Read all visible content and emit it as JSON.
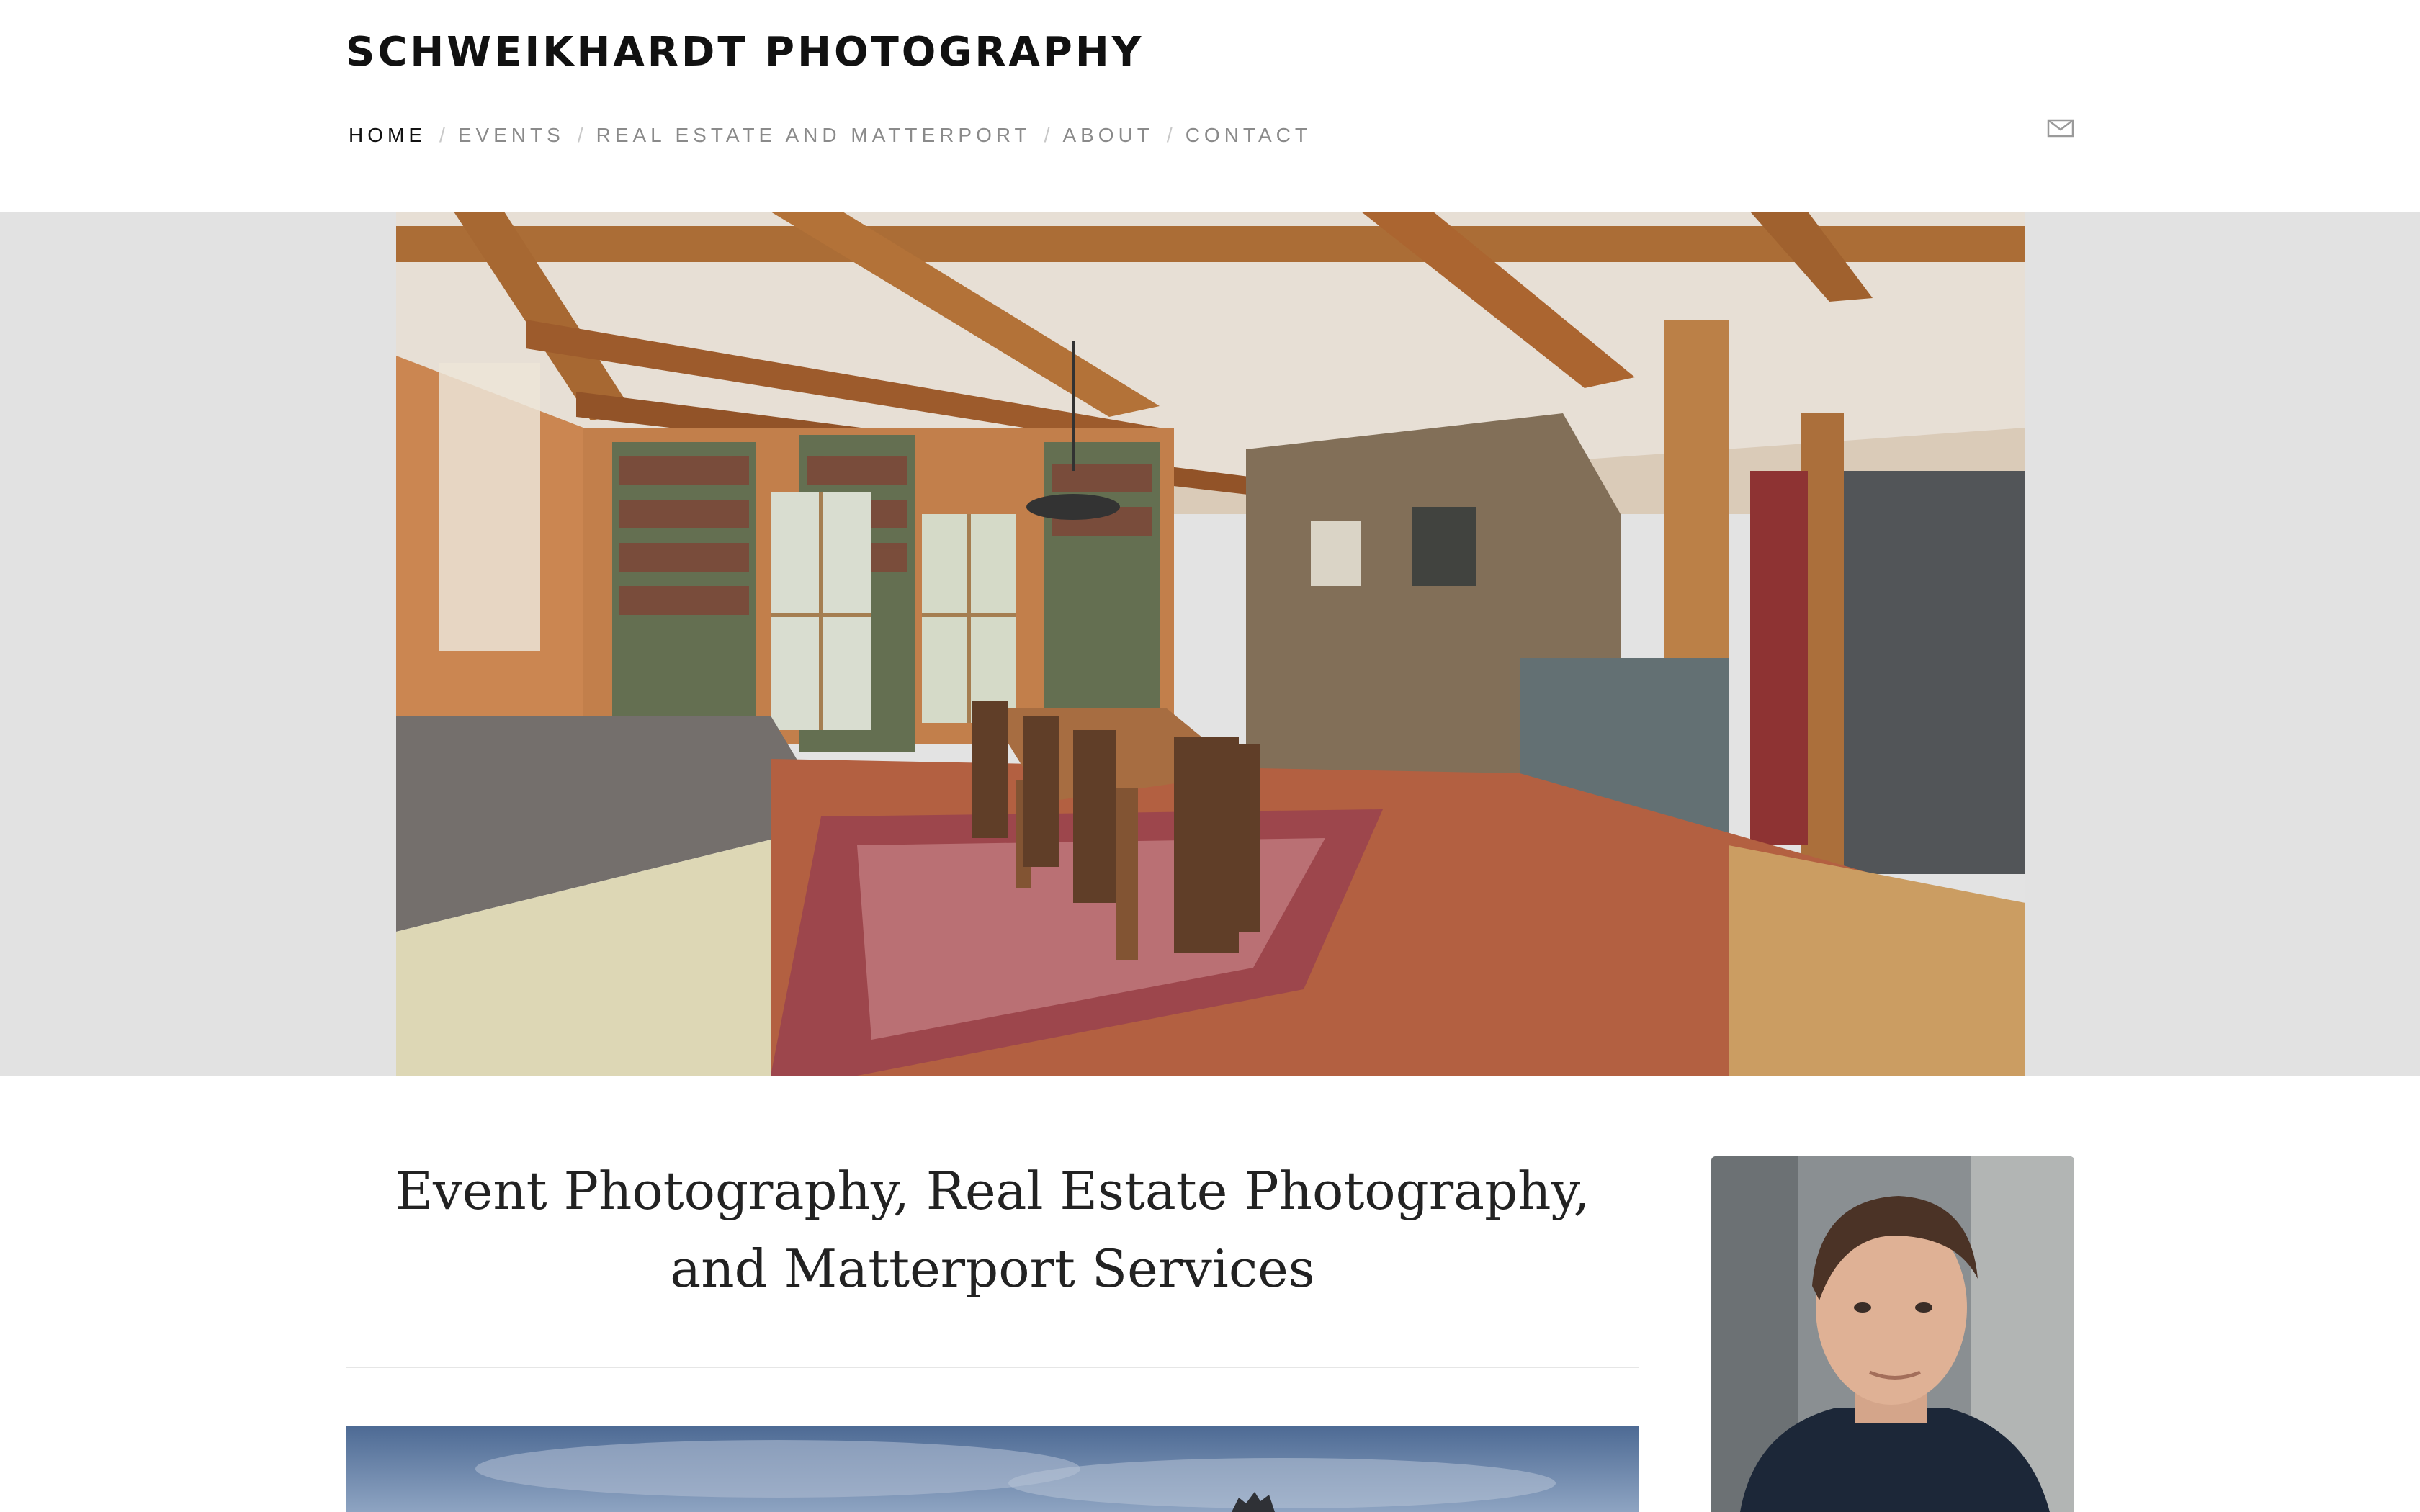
{
  "site": {
    "title": "SCHWEIKHARDT PHOTOGRAPHY"
  },
  "nav": {
    "separator": "/",
    "items": [
      {
        "label": "HOME",
        "active": true
      },
      {
        "label": "EVENTS",
        "active": false
      },
      {
        "label": "REAL ESTATE AND MATTERPORT",
        "active": false
      },
      {
        "label": "ABOUT",
        "active": false
      },
      {
        "label": "CONTACT",
        "active": false
      }
    ]
  },
  "header": {
    "icon": "mail-icon"
  },
  "hero": {
    "image": "dining-room-interior-photo"
  },
  "intro": {
    "heading": "Event Photography, Real Estate Photography, and Matterport Services",
    "feature_image": "sky-landscape-photo"
  },
  "sidebar": {
    "image": "photographer-portrait"
  },
  "colors": {
    "background": "#ffffff",
    "hero_band": "#e2e2e2",
    "nav_active": "#111111",
    "nav_inactive": "#8a8a8a",
    "heading": "#222222",
    "divider": "#e6e6e6"
  }
}
